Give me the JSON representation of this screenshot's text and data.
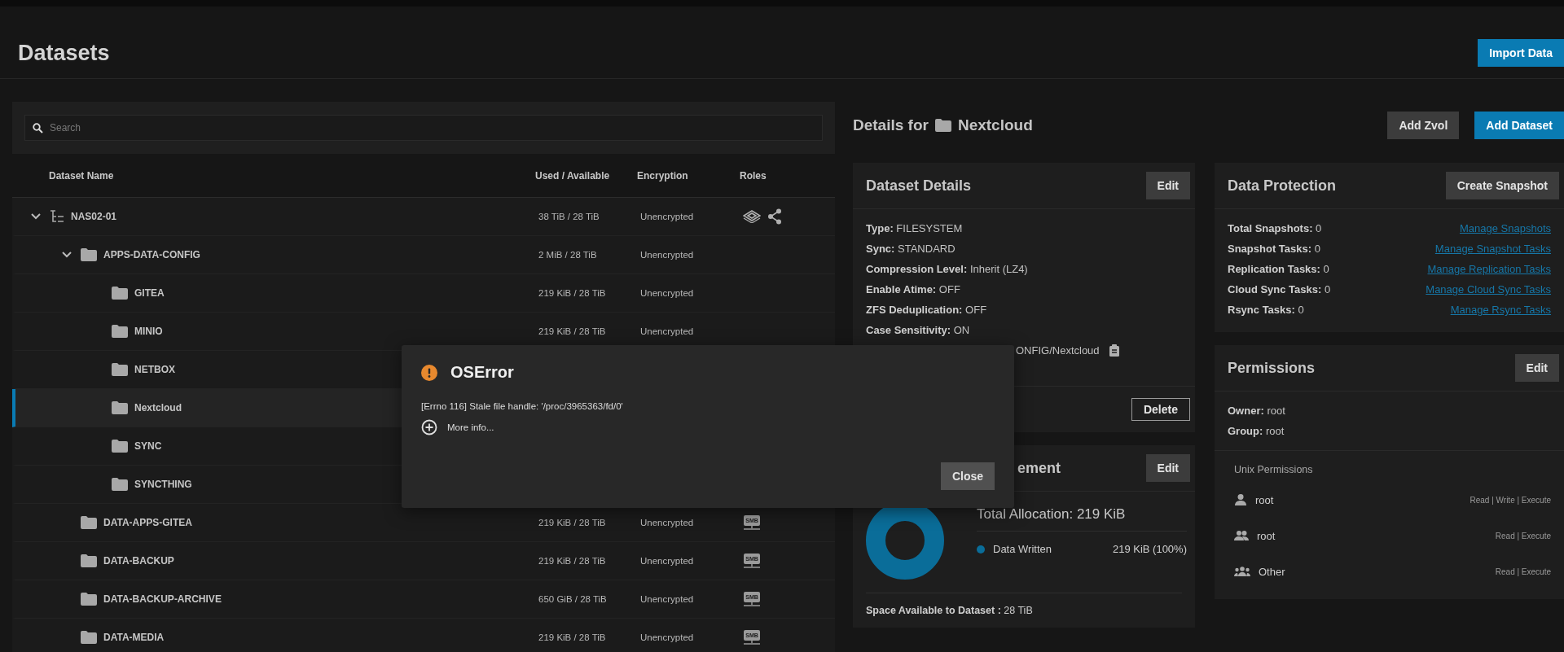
{
  "page": {
    "title": "Datasets",
    "import_button": "Import Data"
  },
  "search": {
    "placeholder": "Search"
  },
  "table": {
    "columns": [
      "Dataset Name",
      "Used / Available",
      "Encryption",
      "Roles"
    ],
    "tree": [
      {
        "kind": "pool",
        "name": "NAS02-01",
        "used": "38 TiB / 28 TiB",
        "encryption": "Unencrypted",
        "expanded": true,
        "selected": false,
        "roles": [
          {
            "kind": "dataset"
          },
          {
            "kind": "share"
          }
        ],
        "children": [
          {
            "kind": "folder",
            "name": "APPS-DATA-CONFIG",
            "used": "2 MiB / 28 TiB",
            "encryption": "Unencrypted",
            "expanded": true,
            "selected": false,
            "children": [
              {
                "kind": "folder",
                "name": "GITEA",
                "used": "219 KiB / 28 TiB",
                "encryption": "Unencrypted",
                "selected": false
              },
              {
                "kind": "folder",
                "name": "MINIO",
                "used": "219 KiB / 28 TiB",
                "encryption": "Unencrypted",
                "selected": false
              },
              {
                "kind": "folder",
                "name": "NETBOX",
                "selected": false
              },
              {
                "kind": "folder",
                "name": "Nextcloud",
                "selected": true
              },
              {
                "kind": "folder",
                "name": "SYNC",
                "selected": false
              },
              {
                "kind": "folder",
                "name": "SYNCTHING",
                "selected": false
              }
            ]
          },
          {
            "kind": "folder",
            "name": "DATA-APPS-GITEA",
            "used": "219 KiB / 28 TiB",
            "encryption": "Unencrypted",
            "selected": false,
            "roles": [
              {
                "kind": "smb",
                "label": "SMB"
              }
            ]
          },
          {
            "kind": "folder",
            "name": "DATA-BACKUP",
            "used": "219 KiB / 28 TiB",
            "encryption": "Unencrypted",
            "selected": false,
            "roles": [
              {
                "kind": "smb",
                "label": "SMB"
              }
            ]
          },
          {
            "kind": "folder",
            "name": "DATA-BACKUP-ARCHIVE",
            "used": "650 GiB / 28 TiB",
            "encryption": "Unencrypted",
            "selected": false,
            "roles": [
              {
                "kind": "smb",
                "label": "SMB"
              }
            ]
          },
          {
            "kind": "folder",
            "name": "DATA-MEDIA",
            "used": "219 KiB / 28 TiB",
            "encryption": "Unencrypted",
            "selected": false,
            "roles": [
              {
                "kind": "smb",
                "label": "SMB"
              }
            ]
          }
        ]
      }
    ]
  },
  "details": {
    "heading": "Details for",
    "name": "Nextcloud",
    "buttons": [
      "Add Zvol",
      "Add Dataset"
    ]
  },
  "dataset_details": {
    "title": "Dataset Details",
    "edit": "Edit",
    "fields": [
      {
        "label": "Type:",
        "value": "FILESYSTEM"
      },
      {
        "label": "Sync:",
        "value": "STANDARD"
      },
      {
        "label": "Compression Level:",
        "value": "Inherit (LZ4)"
      },
      {
        "label": "Enable Atime:",
        "value": "OFF"
      },
      {
        "label": "ZFS Deduplication:",
        "value": "OFF"
      },
      {
        "label": "Case Sensitivity:",
        "value": "ON"
      }
    ],
    "path_fragment": "ONFIG/Nextcloud",
    "delete": "Delete"
  },
  "space": {
    "title_fragment": "ement",
    "edit": "Edit",
    "total_label": "Total Allocation:",
    "total": "219 KiB",
    "legend": [
      {
        "label": "Data Written",
        "value": "219 KiB (100%)",
        "color": "#0a6d99"
      }
    ],
    "available_label": "Space Available to Dataset :",
    "available": "28 TiB"
  },
  "data_protection": {
    "title": "Data Protection",
    "button": "Create Snapshot",
    "rows": [
      {
        "label": "Total Snapshots:",
        "value": "0",
        "link": "Manage Snapshots"
      },
      {
        "label": "Snapshot Tasks:",
        "value": "0",
        "link": "Manage Snapshot Tasks"
      },
      {
        "label": "Replication Tasks:",
        "value": "0",
        "link": "Manage Replication Tasks"
      },
      {
        "label": "Cloud Sync Tasks:",
        "value": "0",
        "link": "Manage Cloud Sync Tasks"
      },
      {
        "label": "Rsync Tasks:",
        "value": "0",
        "link": "Manage Rsync Tasks"
      }
    ]
  },
  "permissions": {
    "title": "Permissions",
    "edit": "Edit",
    "owner_label": "Owner:",
    "owner": "root",
    "group_label": "Group:",
    "group": "root",
    "unix_title": "Unix Permissions",
    "entries": [
      {
        "kind": "user",
        "name": "root",
        "perms": "Read | Write | Execute"
      },
      {
        "kind": "group",
        "name": "root",
        "perms": "Read | Execute"
      },
      {
        "kind": "other",
        "name": "Other",
        "perms": "Read | Execute"
      }
    ]
  },
  "dialog": {
    "title": "OSError",
    "message": "[Errno 116] Stale file handle: '/proc/3965363/fd/0'",
    "more": "More info...",
    "close": "Close"
  }
}
